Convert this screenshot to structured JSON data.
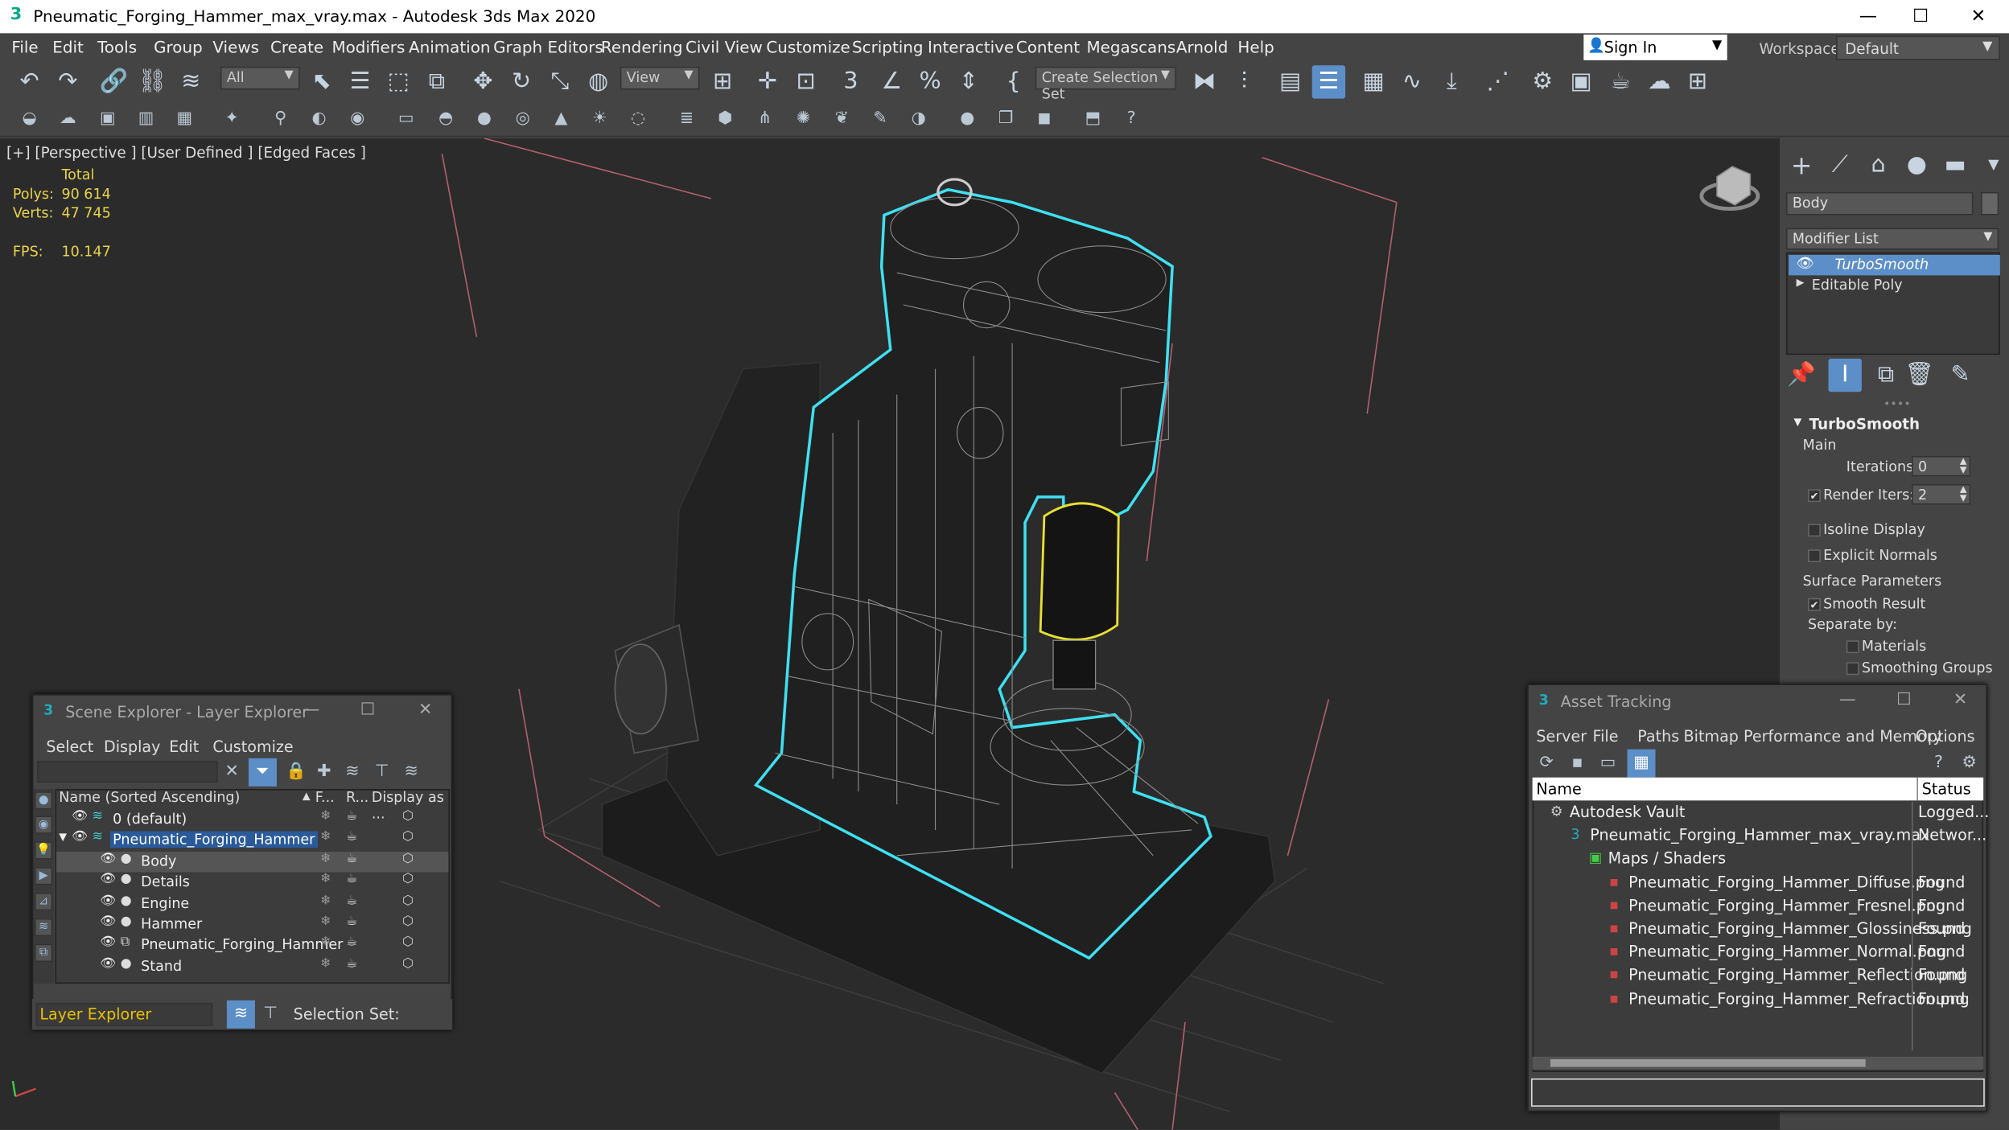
{
  "window": {
    "title": "Pneumatic_Forging_Hammer_max_vray.max - Autodesk 3ds Max 2020",
    "app_icon": "3",
    "controls": {
      "minimize": "—",
      "maximize": "☐",
      "close": "✕"
    }
  },
  "menu": [
    "File",
    "Edit",
    "Tools",
    "Group",
    "Views",
    "Create",
    "Modifiers",
    "Animation",
    "Graph Editors",
    "Rendering",
    "Civil View",
    "Customize",
    "Scripting",
    "Interactive",
    "Content",
    "Megascans",
    "Arnold",
    "Help"
  ],
  "signin": {
    "label": "Sign In"
  },
  "workspaces": {
    "label": "Workspaces:",
    "value": "Default"
  },
  "toolbar": {
    "filter_value": "All",
    "refcoord_value": "View",
    "selection_set_placeholder": "Create Selection Set"
  },
  "viewport": {
    "label": "[+] [Perspective ] [User Defined ] [Edged Faces ]",
    "stats_total_label": "Total",
    "polys_label": "Polys:",
    "polys_value": "90 614",
    "verts_label": "Verts:",
    "verts_value": "47 745",
    "fps_label": "FPS:",
    "fps_value": "10.147"
  },
  "command_panel": {
    "object_name": "Body",
    "modifier_list_label": "Modifier List",
    "stack": [
      "TurboSmooth",
      "Editable Poly"
    ],
    "rollout_title": "TurboSmooth",
    "main_label": "Main",
    "iterations_label": "Iterations:",
    "iterations_value": "0",
    "render_iters_label": "Render Iters:",
    "render_iters_value": "2",
    "render_iters_checked": true,
    "isoline_label": "Isoline Display",
    "explicit_normals_label": "Explicit Normals",
    "surface_params_label": "Surface Parameters",
    "smooth_result_label": "Smooth Result",
    "smooth_result_checked": true,
    "separate_by_label": "Separate by:",
    "materials_label": "Materials",
    "smoothing_groups_label": "Smoothing Groups"
  },
  "scene_explorer": {
    "title": "Scene Explorer - Layer Explorer",
    "menu": [
      "Select",
      "Display",
      "Edit",
      "Customize"
    ],
    "columns": [
      "Name (Sorted Ascending)",
      "F...",
      "R...",
      "Display as ..."
    ],
    "rows": [
      {
        "name": "0 (default)",
        "level": 0,
        "type": "layer"
      },
      {
        "name": "Pneumatic_Forging_Hammer",
        "level": 0,
        "type": "layer",
        "selected": true
      },
      {
        "name": "Body",
        "level": 1,
        "type": "object",
        "highlight": true
      },
      {
        "name": "Details",
        "level": 1,
        "type": "object"
      },
      {
        "name": "Engine",
        "level": 1,
        "type": "object"
      },
      {
        "name": "Hammer",
        "level": 1,
        "type": "object"
      },
      {
        "name": "Pneumatic_Forging_Hammer",
        "level": 1,
        "type": "group"
      },
      {
        "name": "Stand",
        "level": 1,
        "type": "object"
      }
    ],
    "footer_dropdown": "Layer Explorer",
    "selection_set_label": "Selection Set:"
  },
  "asset_tracking": {
    "title": "Asset Tracking",
    "menu": [
      "Server",
      "File",
      "Paths",
      "Bitmap Performance and Memory",
      "Options"
    ],
    "columns": [
      "Name",
      "Status"
    ],
    "rows": [
      {
        "name": "Autodesk Vault",
        "status": "Logged...",
        "level": 0,
        "icon": "vault"
      },
      {
        "name": "Pneumatic_Forging_Hammer_max_vray.max",
        "status": "Networ...",
        "level": 1,
        "icon": "max"
      },
      {
        "name": "Maps / Shaders",
        "status": "",
        "level": 2,
        "icon": "folder"
      },
      {
        "name": "Pneumatic_Forging_Hammer_Diffuse.png",
        "status": "Found",
        "level": 3,
        "icon": "png"
      },
      {
        "name": "Pneumatic_Forging_Hammer_Fresnel.png",
        "status": "Found",
        "level": 3,
        "icon": "png"
      },
      {
        "name": "Pneumatic_Forging_Hammer_Glossiness.png",
        "status": "Found",
        "level": 3,
        "icon": "png"
      },
      {
        "name": "Pneumatic_Forging_Hammer_Normal.png",
        "status": "Found",
        "level": 3,
        "icon": "png"
      },
      {
        "name": "Pneumatic_Forging_Hammer_Reflection.png",
        "status": "Found",
        "level": 3,
        "icon": "png"
      },
      {
        "name": "Pneumatic_Forging_Hammer_Refraction.png",
        "status": "Found",
        "level": 3,
        "icon": "png"
      }
    ]
  },
  "colors": {
    "accent": "#5c8ec8",
    "stats_yellow": "#e8d44a",
    "selection_cyan": "#3fe0f0",
    "viewport_bg": "#2b2b2b"
  }
}
